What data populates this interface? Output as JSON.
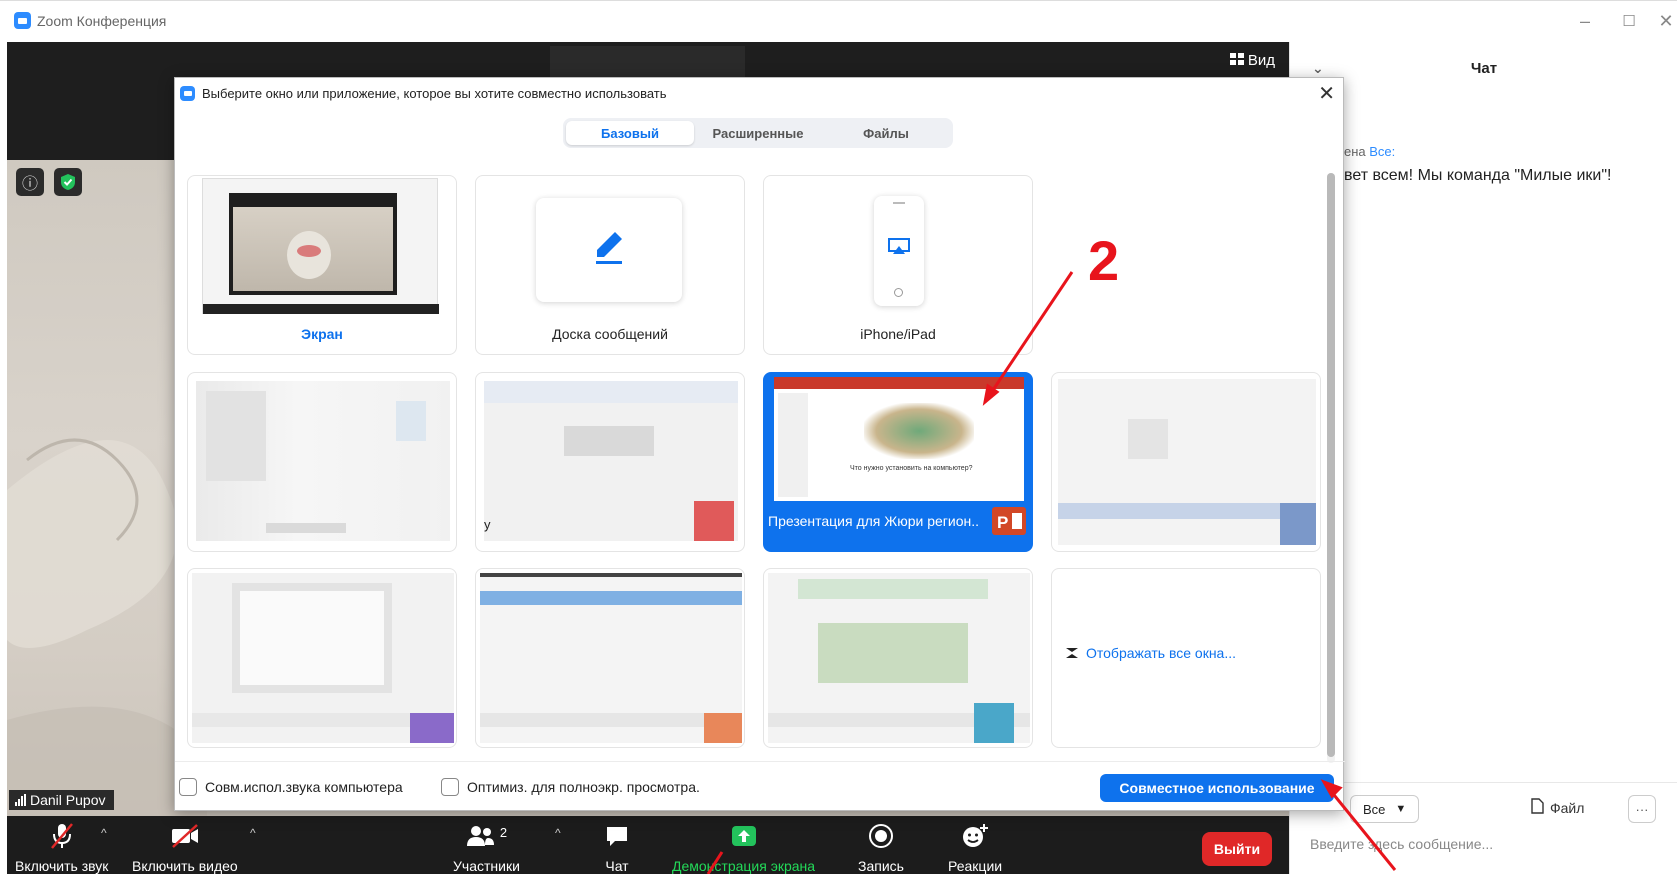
{
  "window": {
    "title": "Zoom Конференция",
    "minimize": "–",
    "maximize": "☐",
    "close": "✕"
  },
  "video": {
    "view_label": "Вид",
    "participant_name": "Danil Pupov"
  },
  "toolbar": {
    "unmute": "Включить звук",
    "start_video": "Включить видео",
    "participants": "Участники",
    "participants_count": "2",
    "chat": "Чат",
    "share_screen": "Демонстрация экрана",
    "record": "Запись",
    "reactions": "Реакции",
    "leave": "Выйти"
  },
  "chat": {
    "title": "Чат",
    "message_from": "ена",
    "message_to": "Все:",
    "message_text": "вет всем! Мы команда \"Милые ики\"!",
    "recipient": "Все",
    "file_button": "Файл",
    "more": "···",
    "input_placeholder": "Введите здесь сообщение..."
  },
  "dialog": {
    "title": "Выберите окно или приложение, которое вы хотите совместно использовать",
    "tabs": [
      {
        "label": "Базовый",
        "active": true
      },
      {
        "label": "Расширенные",
        "active": false
      },
      {
        "label": "Файлы",
        "active": false
      }
    ],
    "tiles": {
      "screen": "Экран",
      "whiteboard": "Доска сообщений",
      "iphone": "iPhone/iPad",
      "presentation": "Презентация для Жюри регион...",
      "presentation_slide_caption": "Что нужно установить на компьютер?",
      "window_partial": "у",
      "show_all": "Отображать все окна..."
    },
    "footer": {
      "share_audio": "Совм.испол.звука компьютера",
      "optimize": "Оптимиз. для полноэкр. просмотра.",
      "share_button": "Совместное использование"
    }
  },
  "annotations": {
    "step_number": "2"
  },
  "colors": {
    "accent": "#0e72ed",
    "leave": "#e02828",
    "share_green": "#23d959",
    "annotation_red": "#e8141c"
  }
}
